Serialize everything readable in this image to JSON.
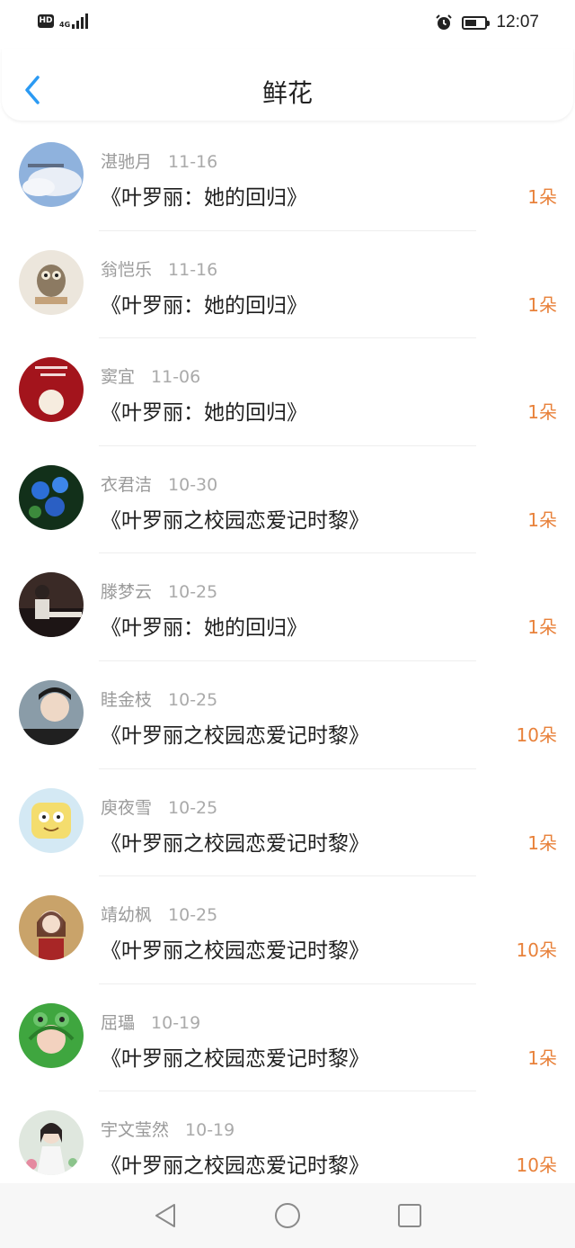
{
  "status_bar": {
    "hd_badge": "HD",
    "network": "4G",
    "time": "12:07",
    "battery_level": 0.6
  },
  "header": {
    "title": "鲜花",
    "back_icon": "chevron-left-icon",
    "accent_color": "#2b9af3"
  },
  "list": {
    "count_color": "#e8813a",
    "items": [
      {
        "name": "湛驰月",
        "date": "11-16",
        "book": "《叶罗丽：她的回归》",
        "count": "1朵"
      },
      {
        "name": "翁恺乐",
        "date": "11-16",
        "book": "《叶罗丽：她的回归》",
        "count": "1朵"
      },
      {
        "name": "窦宜",
        "date": "11-06",
        "book": "《叶罗丽：她的回归》",
        "count": "1朵"
      },
      {
        "name": "衣君洁",
        "date": "10-30",
        "book": "《叶罗丽之校园恋爱记时黎》",
        "count": "1朵"
      },
      {
        "name": "滕梦云",
        "date": "10-25",
        "book": "《叶罗丽：她的回归》",
        "count": "1朵"
      },
      {
        "name": "眭金枝",
        "date": "10-25",
        "book": "《叶罗丽之校园恋爱记时黎》",
        "count": "10朵"
      },
      {
        "name": "庾夜雪",
        "date": "10-25",
        "book": "《叶罗丽之校园恋爱记时黎》",
        "count": "1朵"
      },
      {
        "name": "靖幼枫",
        "date": "10-25",
        "book": "《叶罗丽之校园恋爱记时黎》",
        "count": "10朵"
      },
      {
        "name": "屈瓃",
        "date": "10-19",
        "book": "《叶罗丽之校园恋爱记时黎》",
        "count": "1朵"
      },
      {
        "name": "宇文莹然",
        "date": "10-19",
        "book": "《叶罗丽之校园恋爱记时黎》",
        "count": "10朵"
      }
    ]
  },
  "navbar": {
    "back_icon": "triangle-back-icon",
    "home_icon": "circle-home-icon",
    "recent_icon": "square-recent-icon"
  }
}
